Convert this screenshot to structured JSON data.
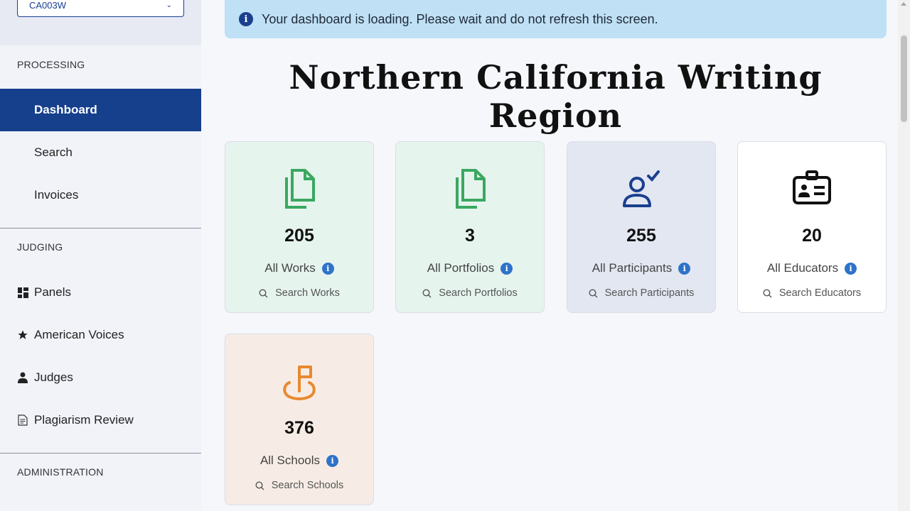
{
  "sidebar": {
    "region_select_value": "CA003W",
    "sections": {
      "processing": "PROCESSING",
      "judging": "JUDGING",
      "administration": "ADMINISTRATION"
    },
    "processing_items": [
      {
        "label": "Dashboard",
        "active": true
      },
      {
        "label": "Search"
      },
      {
        "label": "Invoices"
      }
    ],
    "judging_items": [
      {
        "label": "Panels",
        "icon": "grid-icon"
      },
      {
        "label": "American Voices",
        "icon": "star-icon"
      },
      {
        "label": "Judges",
        "icon": "person-icon"
      },
      {
        "label": "Plagiarism Review",
        "icon": "document-icon"
      }
    ]
  },
  "alert": {
    "icon": "info-icon",
    "text": "Your dashboard is loading. Please wait and do not refresh this screen."
  },
  "page_title": "Northern California Writing Region",
  "cards": [
    {
      "count": "205",
      "label": "All Works",
      "search": "Search Works",
      "icon": "documents-icon",
      "color": "#e6f4ee",
      "icon_color": "#3aa860"
    },
    {
      "count": "3",
      "label": "All Portfolios",
      "search": "Search Portfolios",
      "icon": "documents-icon",
      "color": "#e6f4ee",
      "icon_color": "#3aa860"
    },
    {
      "count": "255",
      "label": "All Participants",
      "search": "Search Participants",
      "icon": "person-check-icon",
      "color": "#e3e7f2",
      "icon_color": "#1a3f8f"
    },
    {
      "count": "20",
      "label": "All Educators",
      "search": "Search Educators",
      "icon": "id-badge-icon",
      "color": "#ffffff",
      "icon_color": "#111111"
    },
    {
      "count": "376",
      "label": "All Schools",
      "search": "Search Schools",
      "icon": "flag-location-icon",
      "color": "#f7ece5",
      "icon_color": "#e8892e"
    }
  ],
  "colors": {
    "primary": "#163f8c",
    "info_badge": "#2f73c9",
    "alert_bg": "#bfe0f5"
  }
}
